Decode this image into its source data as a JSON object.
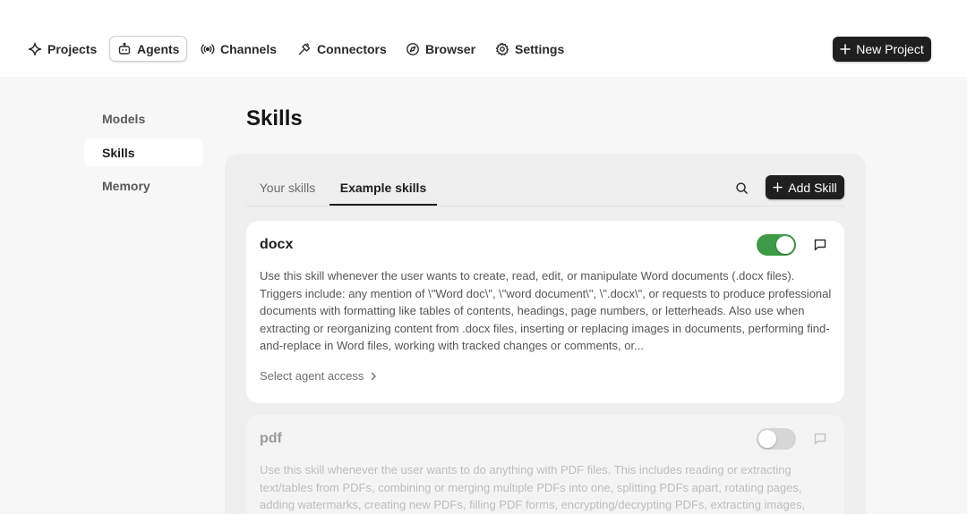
{
  "nav": {
    "items": [
      {
        "label": "Projects",
        "icon": "sparkle-icon"
      },
      {
        "label": "Agents",
        "icon": "robot-icon"
      },
      {
        "label": "Channels",
        "icon": "broadcast-icon"
      },
      {
        "label": "Connectors",
        "icon": "plug-icon"
      },
      {
        "label": "Browser",
        "icon": "compass-icon"
      },
      {
        "label": "Settings",
        "icon": "gear-icon"
      }
    ],
    "active": "Agents",
    "new_project_label": "New Project"
  },
  "sidebar": {
    "items": [
      {
        "label": "Models"
      },
      {
        "label": "Skills"
      },
      {
        "label": "Memory"
      }
    ],
    "active": "Skills"
  },
  "page": {
    "title": "Skills"
  },
  "tabs": [
    {
      "label": "Your skills",
      "active": false
    },
    {
      "label": "Example skills",
      "active": true
    }
  ],
  "toolbar": {
    "search_icon": "search-icon",
    "add_skill_label": "Add Skill"
  },
  "skills": [
    {
      "name": "docx",
      "enabled": true,
      "description": "Use this skill whenever the user wants to create, read, edit, or manipulate Word documents (.docx files). Triggers include: any mention of \\\"Word doc\\\", \\\"word document\\\", \\\".docx\\\", or requests to produce professional documents with formatting like tables of contents, headings, page numbers, or letterheads. Also use when extracting or reorganizing content from .docx files, inserting or replacing images in documents, performing find-and-replace in Word files, working with tracked changes or comments, or...",
      "access_label": "Select agent access"
    },
    {
      "name": "pdf",
      "enabled": false,
      "description": "Use this skill whenever the user wants to do anything with PDF files. This includes reading or extracting text/tables from PDFs, combining or merging multiple PDFs into one, splitting PDFs apart, rotating pages, adding watermarks, creating new PDFs, filling PDF forms, encrypting/decrypting PDFs, extracting images,"
    }
  ],
  "colors": {
    "toggle_on": "#3e9a47",
    "toggle_off": "#d6d6d6",
    "dark_button": "#1f1f1f"
  }
}
